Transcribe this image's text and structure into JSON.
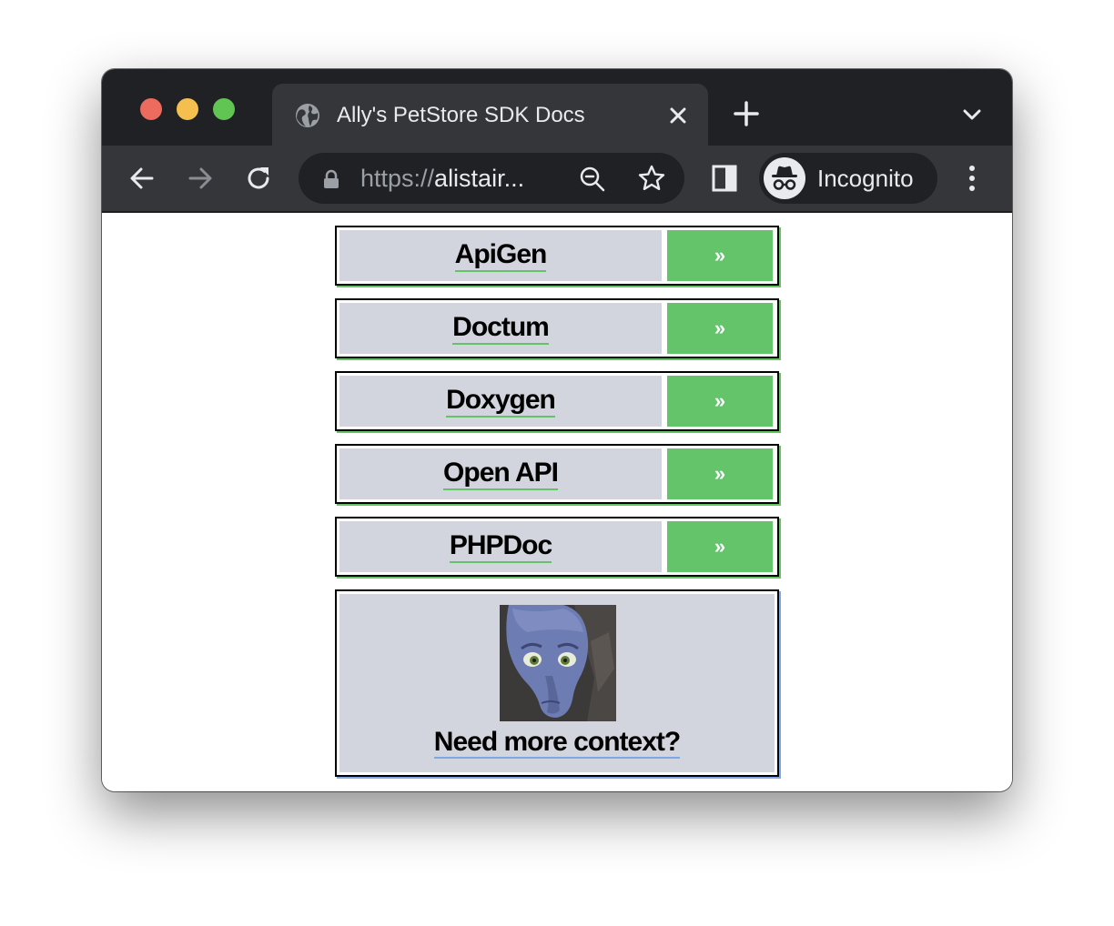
{
  "browser": {
    "tab_title": "Ally's PetStore SDK Docs",
    "url_scheme": "https://",
    "url_host": "alistair...",
    "profile_label": "Incognito",
    "icons": {
      "favicon": "globe-icon",
      "close": "close-icon",
      "new_tab": "plus-icon",
      "tab_search": "chevron-down-icon",
      "back": "arrow-left-icon",
      "forward": "arrow-right-icon",
      "reload": "reload-icon",
      "lock": "lock-icon",
      "zoom": "zoom-out-icon",
      "bookmark": "star-icon",
      "side_panel": "side-panel-icon",
      "incognito": "incognito-icon",
      "menu": "kebab-menu-icon"
    }
  },
  "page": {
    "links": [
      {
        "label": "ApiGen",
        "button": "»"
      },
      {
        "label": "Doctum",
        "button": "»"
      },
      {
        "label": "Doxygen",
        "button": "»"
      },
      {
        "label": "Open API",
        "button": "»"
      },
      {
        "label": "PHPDoc",
        "button": "»"
      }
    ],
    "context_card": {
      "label": "Need more context?"
    },
    "colors": {
      "card_bg": "#d2d5dd",
      "go_button": "#64c46a",
      "link_underline": "#66c266",
      "context_underline": "#7ea7e6"
    }
  }
}
